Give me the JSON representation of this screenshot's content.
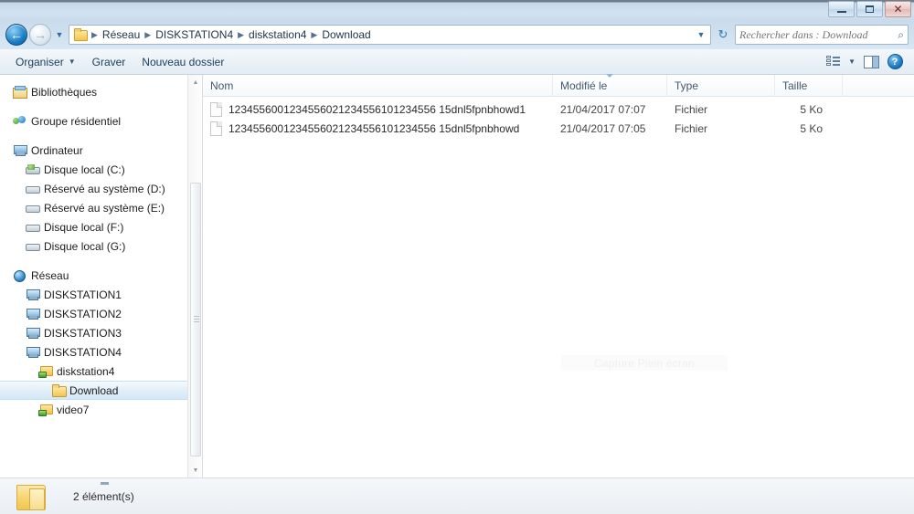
{
  "window": {
    "controls": {
      "minimize_label": "Réduire",
      "maximize_label": "Agrandir",
      "close_label": "Fermer"
    }
  },
  "address_bar": {
    "back_label": "Précédent",
    "forward_label": "Suivant",
    "recent_label": "Emplacements récents",
    "breadcrumbs": [
      "Réseau",
      "DISKSTATION4",
      "diskstation4",
      "Download"
    ],
    "separator": "▶",
    "dropdown_label": "▼",
    "refresh_label": "Actualiser"
  },
  "search": {
    "placeholder": "Rechercher dans : Download",
    "value": ""
  },
  "toolbar": {
    "organize_label": "Organiser",
    "organize_caret": "▼",
    "burn_label": "Graver",
    "new_folder_label": "Nouveau dossier",
    "view_caret": "▼"
  },
  "sidebar": {
    "items": [
      {
        "label": "Bibliothèques",
        "icon": "library-icon",
        "indent": 0,
        "group": false,
        "selected": false
      },
      {
        "label": "Groupe résidentiel",
        "icon": "homegroup-icon",
        "indent": 0,
        "group": true,
        "selected": false
      },
      {
        "label": "Ordinateur",
        "icon": "computer-icon",
        "indent": 0,
        "group": true,
        "selected": false
      },
      {
        "label": "Disque local (C:)",
        "icon": "windows-drive-icon",
        "indent": 1,
        "group": false,
        "selected": false
      },
      {
        "label": "Réservé au système (D:)",
        "icon": "drive-icon",
        "indent": 1,
        "group": false,
        "selected": false
      },
      {
        "label": "Réservé au système (E:)",
        "icon": "drive-icon",
        "indent": 1,
        "group": false,
        "selected": false
      },
      {
        "label": "Disque local (F:)",
        "icon": "drive-icon",
        "indent": 1,
        "group": false,
        "selected": false
      },
      {
        "label": "Disque local (G:)",
        "icon": "drive-icon",
        "indent": 1,
        "group": false,
        "selected": false
      },
      {
        "label": "Réseau",
        "icon": "network-icon",
        "indent": 0,
        "group": true,
        "selected": false
      },
      {
        "label": "DISKSTATION1",
        "icon": "server-icon",
        "indent": 1,
        "group": false,
        "selected": false
      },
      {
        "label": "DISKSTATION2",
        "icon": "server-icon",
        "indent": 1,
        "group": false,
        "selected": false
      },
      {
        "label": "DISKSTATION3",
        "icon": "server-icon",
        "indent": 1,
        "group": false,
        "selected": false
      },
      {
        "label": "DISKSTATION4",
        "icon": "server-icon",
        "indent": 1,
        "group": false,
        "selected": false
      },
      {
        "label": "diskstation4",
        "icon": "share-icon",
        "indent": 2,
        "group": false,
        "selected": false
      },
      {
        "label": "Download",
        "icon": "folder-icon",
        "indent": 3,
        "group": false,
        "selected": true
      },
      {
        "label": "video7",
        "icon": "share-icon",
        "indent": 2,
        "group": false,
        "selected": false
      }
    ]
  },
  "file_list": {
    "columns": {
      "name": "Nom",
      "date": "Modifié le",
      "type": "Type",
      "size": "Taille"
    },
    "sorted_column": "Modifié le",
    "rows": [
      {
        "name": "1234556001234556021234556101234556 15dnl5fpnbhowd1",
        "date": "21/04/2017 07:07",
        "type": "Fichier",
        "size": "5 Ko"
      },
      {
        "name": "1234556001234556021234556101234556 15dnl5fpnbhowd",
        "date": "21/04/2017 07:05",
        "type": "Fichier",
        "size": "5 Ko"
      }
    ]
  },
  "watermark": {
    "text": "Capture Plein écran"
  },
  "status_bar": {
    "item_count_text": "2 élément(s)"
  }
}
